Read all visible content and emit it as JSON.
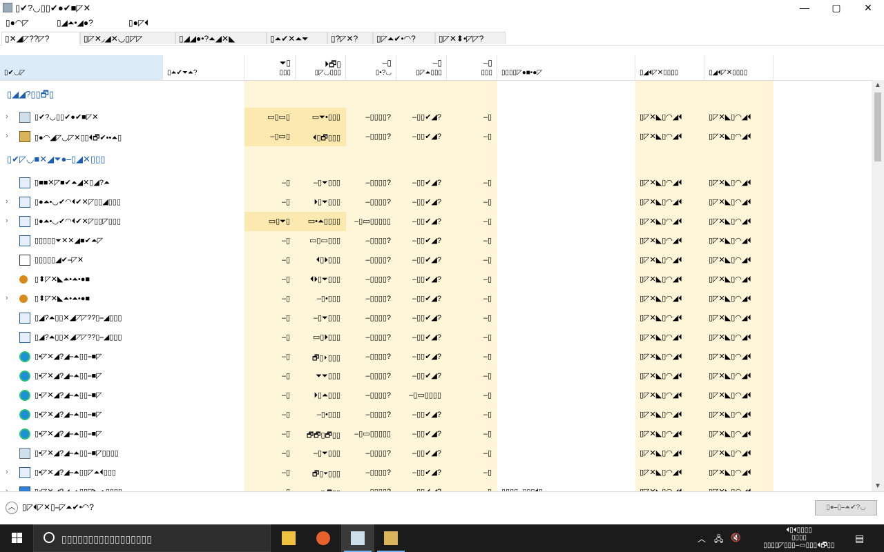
{
  "window": {
    "title": "▯✔?◡▯▯✔●✔■◸✕",
    "controls": {
      "minimize": "—",
      "maximize": "▢",
      "close": "✕"
    }
  },
  "menu": [
    "▯●◠◸",
    "▯◢⏶•◢●?",
    "▯●◸⏴"
  ],
  "tabs": [
    "▯✕◢◸??◸?",
    "▯◸✕◞◢✕◡▯◸◸",
    "▯◢◢●•?⏶◢✕◣",
    "▯⏶✔✕⏶⏷",
    "▯?◸✕?",
    "▯◸⏶✔•◠?",
    "▯◸✕⬍•◸◸?"
  ],
  "columns": [
    {
      "l1": "",
      "l2": "▯✔◡◸"
    },
    {
      "l1": "",
      "l2": "▯⏶✔⏷⏶?"
    },
    {
      "l1": "⏷▯",
      "l2": "▯▯▯"
    },
    {
      "l1": "⏵🗗▯",
      "l2": "▯◸◡▯▯▯"
    },
    {
      "l1": "–▯",
      "l2": "▯•?◡"
    },
    {
      "l1": "–▯",
      "l2": "▯◸⏶▯▯▯"
    },
    {
      "l1": "–▯",
      "l2": "▯▯▯"
    },
    {
      "l1": "",
      "l2": "▯▯▯▯◸●■•●◸"
    },
    {
      "l1": "",
      "l2": "▯◢⏴◸✕▯▯▯▯"
    },
    {
      "l1": "",
      "l2": "▯◢⏴◸✕▯▯▯▯"
    }
  ],
  "groups": [
    {
      "label": "▯◢◢?▯▯🗗▯"
    },
    {
      "label": "▯✔◸◡■✕◢⏷●⎯▯◢✕▯▯▯"
    }
  ],
  "rows": [
    {
      "exp": "›",
      "icon": "img",
      "name": "▯✔?◡▯▯✔●✔■◸✕",
      "c": [
        "▭▯▭▯",
        "▭⏷•▯▯▯",
        "–▯▯▯▯?",
        "–▯▯✔◢?",
        "–▯"
      ],
      "pub": "",
      "d1": "▯◸✕◣▯◠◢⏴",
      "d2": "▯◸✕◣▯◠◢⏴"
    },
    {
      "exp": "›",
      "icon": "lock",
      "name": "▯●◠◢◸◡◸✕▯▯⏴🗗✔••⏶▯",
      "c": [
        "–▯▭▯",
        "⏴▯🗗▯▯▯",
        "–▯▯▯▯?",
        "–▯▯✔◢?",
        "–▯"
      ],
      "pub": "",
      "d1": "▯◸✕◣▯◠◢⏴",
      "d2": "▯◸✕◣▯◠◢⏴"
    },
    {
      "exp": "",
      "icon": "app",
      "name": "▯■■✕◸■✔⏶◢✕▯◢?⏶",
      "c": [
        "–▯",
        "–▯⏷▯▯▯",
        "–▯▯▯▯?",
        "–▯▯✔◢?",
        "–▯"
      ],
      "pub": "",
      "d1": "▯◸✕◣▯◠◢⏴",
      "d2": "▯◸✕◣▯◠◢⏴"
    },
    {
      "exp": "›",
      "icon": "app",
      "name": "▯●⏶•◡✔◠⏴✔✕◸▯▯◢▯▯▯",
      "c": [
        "–▯",
        "⏵▯⏷▯▯▯",
        "–▯▯▯▯?",
        "–▯▯✔◢?",
        "–▯"
      ],
      "pub": "",
      "d1": "▯◸✕◣▯◠◢⏴",
      "d2": "▯◸✕◣▯◠◢⏴"
    },
    {
      "exp": "›",
      "icon": "app",
      "name": "▯●⏶•◡✔◠⏴✔✕◸▯▯◸▯▯▯",
      "c": [
        "▭▯⏷▯",
        "▭•⏶▯▯▯▯",
        "–▯▭▯▯▯▯▯",
        "–▯▯✔◢?",
        "–▯"
      ],
      "pub": "",
      "d1": "▯◸✕◣▯◠◢⏴",
      "d2": "▯◸✕◣▯◠◢⏴"
    },
    {
      "exp": "",
      "icon": "app",
      "name": "▯▯▯▯▯⏷✕✕◢■✔⏶◸",
      "c": [
        "–▯",
        "▭▯▭▯▯▯",
        "–▯▯▯▯?",
        "–▯▯✔◢?",
        "–▯"
      ],
      "pub": "",
      "d1": "▯◸✕◣▯◠◢⏴",
      "d2": "▯◸✕◣▯◠◢⏴"
    },
    {
      "exp": "",
      "icon": "doc",
      "name": "▯▯▯▯▯◢✔⎯◸✕",
      "c": [
        "–▯",
        "⏴▯⏵▯▯▯",
        "–▯▯▯▯?",
        "–▯▯✔◢?",
        "–▯"
      ],
      "pub": "",
      "d1": "▯◸✕◣▯◠◢⏴",
      "d2": "▯◸✕◣▯◠◢⏴"
    },
    {
      "exp": "",
      "icon": "key",
      "name": "▯⬍◸✕◣⏶•⏶•●■",
      "c": [
        "–▯",
        "⏴⏵▯⏷▯▯▯",
        "–▯▯▯▯?",
        "–▯▯✔◢?",
        "–▯"
      ],
      "pub": "",
      "d1": "▯◸✕◣▯◠◢⏴",
      "d2": "▯◸✕◣▯◠◢⏴"
    },
    {
      "exp": "›",
      "icon": "key",
      "name": "▯⬍◸✕◣⏶•⏶•●■",
      "c": [
        "–▯",
        "–▯•▯▯▯",
        "–▯▯▯▯?",
        "–▯▯✔◢?",
        "–▯"
      ],
      "pub": "",
      "d1": "▯◸✕◣▯◠◢⏴",
      "d2": "▯◸✕◣▯◠◢⏴"
    },
    {
      "exp": "",
      "icon": "app",
      "name": "▯◢?⏶▯▯✕◢◸◸??▯⎯◢▯▯▯",
      "c": [
        "–▯",
        "–▯⏷▯▯▯",
        "–▯▯▯▯?",
        "–▯▯✔◢?",
        "–▯"
      ],
      "pub": "",
      "d1": "▯◸✕◣▯◠◢⏴",
      "d2": "▯◸✕◣▯◠◢⏴"
    },
    {
      "exp": "",
      "icon": "app",
      "name": "▯◢?⏶▯▯✕◢◸◸??▯⎯◢▯▯▯",
      "c": [
        "–▯",
        "▭▯⏵▯▯▯",
        "–▯▯▯▯?",
        "–▯▯✔◢?",
        "–▯"
      ],
      "pub": "",
      "d1": "▯◸✕◣▯◠◢⏴",
      "d2": "▯◸✕◣▯◠◢⏴"
    },
    {
      "exp": "",
      "icon": "edge",
      "name": "▯•◸✕◢?◢⎯⏶▯▯⎯■◸",
      "c": [
        "–▯",
        "🗗▯⏵▯▯▯",
        "–▯▯▯▯?",
        "–▯▯✔◢?",
        "–▯"
      ],
      "pub": "",
      "d1": "▯◸✕◣▯◠◢⏴",
      "d2": "▯◸✕◣▯◠◢⏴"
    },
    {
      "exp": "",
      "icon": "edge",
      "name": "▯•◸✕◢?◢⎯⏶▯▯⎯■◸",
      "c": [
        "–▯",
        "⏷⏷▯▯▯",
        "–▯▯▯▯?",
        "–▯▯✔◢?",
        "–▯"
      ],
      "pub": "",
      "d1": "▯◸✕◣▯◠◢⏴",
      "d2": "▯◸✕◣▯◠◢⏴"
    },
    {
      "exp": "",
      "icon": "edge",
      "name": "▯•◸✕◢?◢⎯⏶▯▯⎯■◸",
      "c": [
        "–▯",
        "⏵▯⏶▯▯▯",
        "–▯▯▯▯?",
        "–▯▭▯▯▯▯",
        "–▯"
      ],
      "pub": "",
      "d1": "▯◸✕◣▯◠◢⏴",
      "d2": "▯◸✕◣▯◠◢⏴"
    },
    {
      "exp": "",
      "icon": "edge",
      "name": "▯•◸✕◢?◢⎯⏶▯▯⎯■◸",
      "c": [
        "–▯",
        "–▯•▯▯▯",
        "–▯▯▯▯?",
        "–▯▯✔◢?",
        "–▯"
      ],
      "pub": "",
      "d1": "▯◸✕◣▯◠◢⏴",
      "d2": "▯◸✕◣▯◠◢⏴"
    },
    {
      "exp": "",
      "icon": "edge",
      "name": "▯•◸✕◢?◢⎯⏶▯▯⎯■◸",
      "c": [
        "–▯",
        "🗗🗗▯🗗▯▯",
        "–▯▭▯▯▯▯▯",
        "–▯▯✔◢?",
        "–▯"
      ],
      "pub": "",
      "d1": "▯◸✕◣▯◠◢⏴",
      "d2": "▯◸✕◣▯◠◢⏴"
    },
    {
      "exp": "",
      "icon": "img",
      "name": "▯•◸✕◢?◢⎯⏶▯▯⎯■◸▯▯▯▯",
      "c": [
        "–▯",
        "–▯⏷▯▯▯",
        "–▯▯▯▯?",
        "–▯▯✔◢?",
        "–▯"
      ],
      "pub": "",
      "d1": "▯◸✕◣▯◠◢⏴",
      "d2": "▯◸✕◣▯◠◢⏴"
    },
    {
      "exp": "›",
      "icon": "app",
      "name": "▯•◸✕◢?◢⎯⏶▯▯◸⏶⏴▯▯▯",
      "c": [
        "–▯",
        "🗗▯⏷▯▯▯",
        "–▯▯▯▯?",
        "–▯▯✔◢?",
        "–▯"
      ],
      "pub": "",
      "d1": "▯◸✕◣▯◠◢⏴",
      "d2": "▯◸✕◣▯◠◢⏴"
    },
    {
      "exp": "›",
      "icon": "blue",
      "name": "▯•◸✕◢?◢⎯⏶▯▯◸◣⏶▯▯▯▯",
      "c": [
        "–▯",
        "▭▭▯🗗▯▯",
        "–▯▯▯▯?",
        "–▯▯✔◢?",
        "–▯"
      ],
      "pub": "▯▯▯▯–▯▯▯⏴▯",
      "d1": "▯◸✕◣▯◠◢⏴",
      "d2": "▯◸✕◣▯◠◢⏴"
    }
  ],
  "status": {
    "text": "▯◸⏴◸✕▯⎯◸⏶✔•◠?",
    "button": "▯●⎯▯⎯⏶✔?◡"
  },
  "taskbar": {
    "search_placeholder": "▯▯▯▯▯▯▯▯▯▯▯▯▯▯▯▯▯",
    "clock_l1": "⏴▯⏴▯▯▯▯",
    "clock_l2": "▯▯▯▯",
    "clock_l3": "▯▯▯▯◸▯▯▯–▭▯▯▯⏴🗗▯▯"
  },
  "colors": {
    "highlight_col": "#fff5d8",
    "group_text": "#1a5fb4",
    "selected_header": "#dcebf8",
    "taskbar": "#1b1b1b"
  }
}
